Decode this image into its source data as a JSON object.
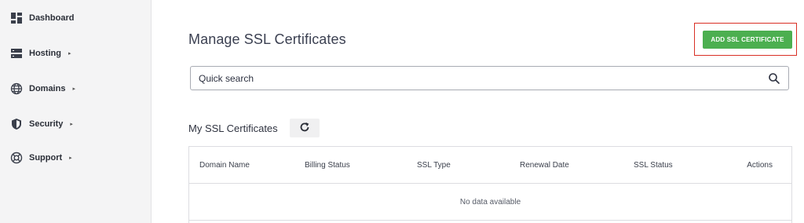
{
  "sidebar": {
    "items": [
      {
        "label": "Dashboard",
        "icon": "dashboard-icon",
        "has_submenu": false
      },
      {
        "label": "Hosting",
        "icon": "server-icon",
        "has_submenu": true
      },
      {
        "label": "Domains",
        "icon": "globe-icon",
        "has_submenu": true
      },
      {
        "label": "Security",
        "icon": "shield-icon",
        "has_submenu": true
      },
      {
        "label": "Support",
        "icon": "lifebuoy-icon",
        "has_submenu": true
      }
    ],
    "caret": "▸"
  },
  "main": {
    "title": "Manage SSL Certificates",
    "add_button_label": "ADD SSL CERTIFICATE",
    "search": {
      "placeholder": "Quick search",
      "value": ""
    },
    "section_title": "My SSL Certificates",
    "table": {
      "columns": [
        "Domain Name",
        "Billing Status",
        "SSL Type",
        "Renewal Date",
        "SSL Status",
        "Actions"
      ],
      "empty_text": "No data available"
    }
  },
  "colors": {
    "accent_green": "#4caf50",
    "highlight_red": "#d93025",
    "sidebar_bg": "#f4f4f5"
  }
}
